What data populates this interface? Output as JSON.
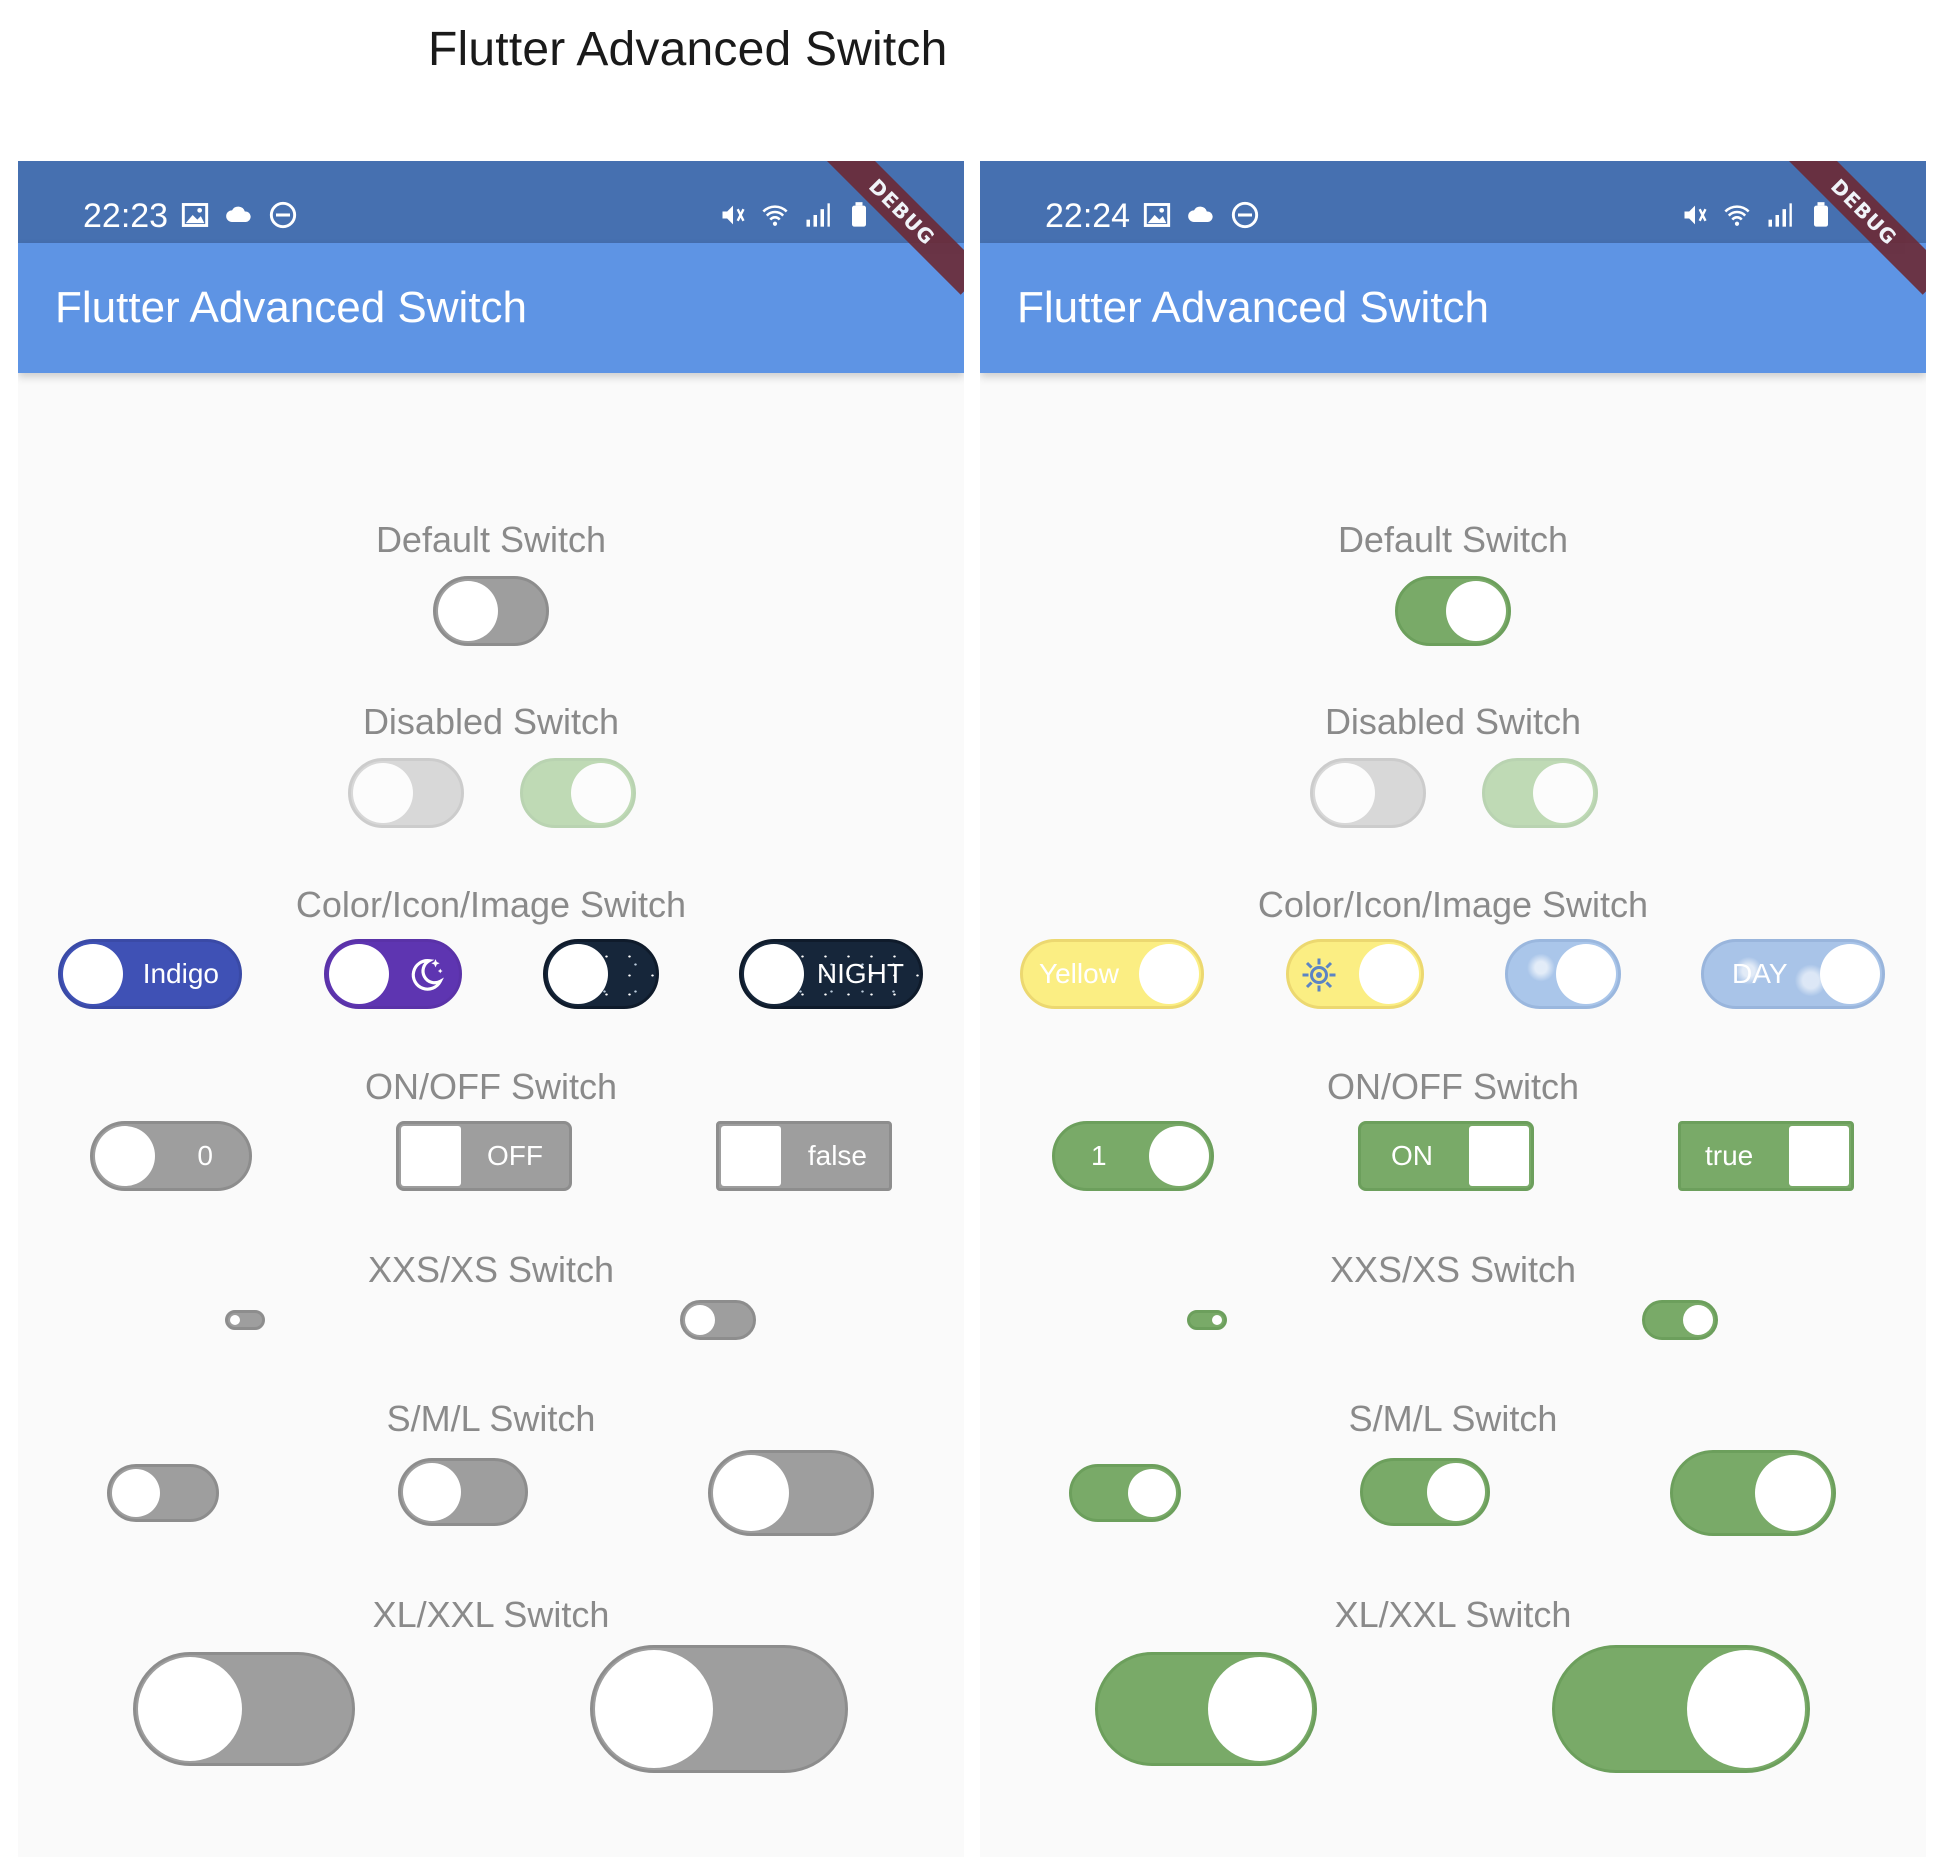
{
  "page_title": "Flutter Advanced Switch",
  "colors": {
    "status_bar": "#4670b0",
    "app_bar": "#5e94e4",
    "background": "#fafafa",
    "off_track": "#9e9e9e",
    "on_track": "#79aa68",
    "label": "#8a8a8a",
    "debug_banner": "#6b2b38"
  },
  "screens": [
    {
      "id": "left",
      "time": "22:23",
      "app_title": "Flutter Advanced Switch",
      "debug_label": "DEBUG",
      "state": "off",
      "sections": {
        "default": "Default Switch",
        "disabled": "Disabled Switch",
        "color_icon_image": "Color/Icon/Image Switch",
        "on_off": "ON/OFF Switch",
        "xxs_xs": "XXS/XS Switch",
        "s_m_l": "S/M/L Switch",
        "xl_xxl": "XL/XXL Switch"
      },
      "color_switch_labels": {
        "indigo": "Indigo",
        "icon": "moon-stars-icon",
        "image": "",
        "text_image": "NIGHT"
      },
      "on_off_labels": {
        "numeric": "0",
        "text": "OFF",
        "bool": "false"
      }
    },
    {
      "id": "right",
      "time": "22:24",
      "app_title": "Flutter Advanced Switch",
      "debug_label": "DEBUG",
      "state": "on",
      "sections": {
        "default": "Default Switch",
        "disabled": "Disabled Switch",
        "color_icon_image": "Color/Icon/Image Switch",
        "on_off": "ON/OFF Switch",
        "xxs_xs": "XXS/XS Switch",
        "s_m_l": "S/M/L Switch",
        "xl_xxl": "XL/XXL Switch"
      },
      "color_switch_labels": {
        "indigo": "Yellow",
        "icon": "sun-icon",
        "image": "",
        "text_image": "DAY"
      },
      "on_off_labels": {
        "numeric": "1",
        "text": "ON",
        "bool": "true"
      }
    }
  ]
}
